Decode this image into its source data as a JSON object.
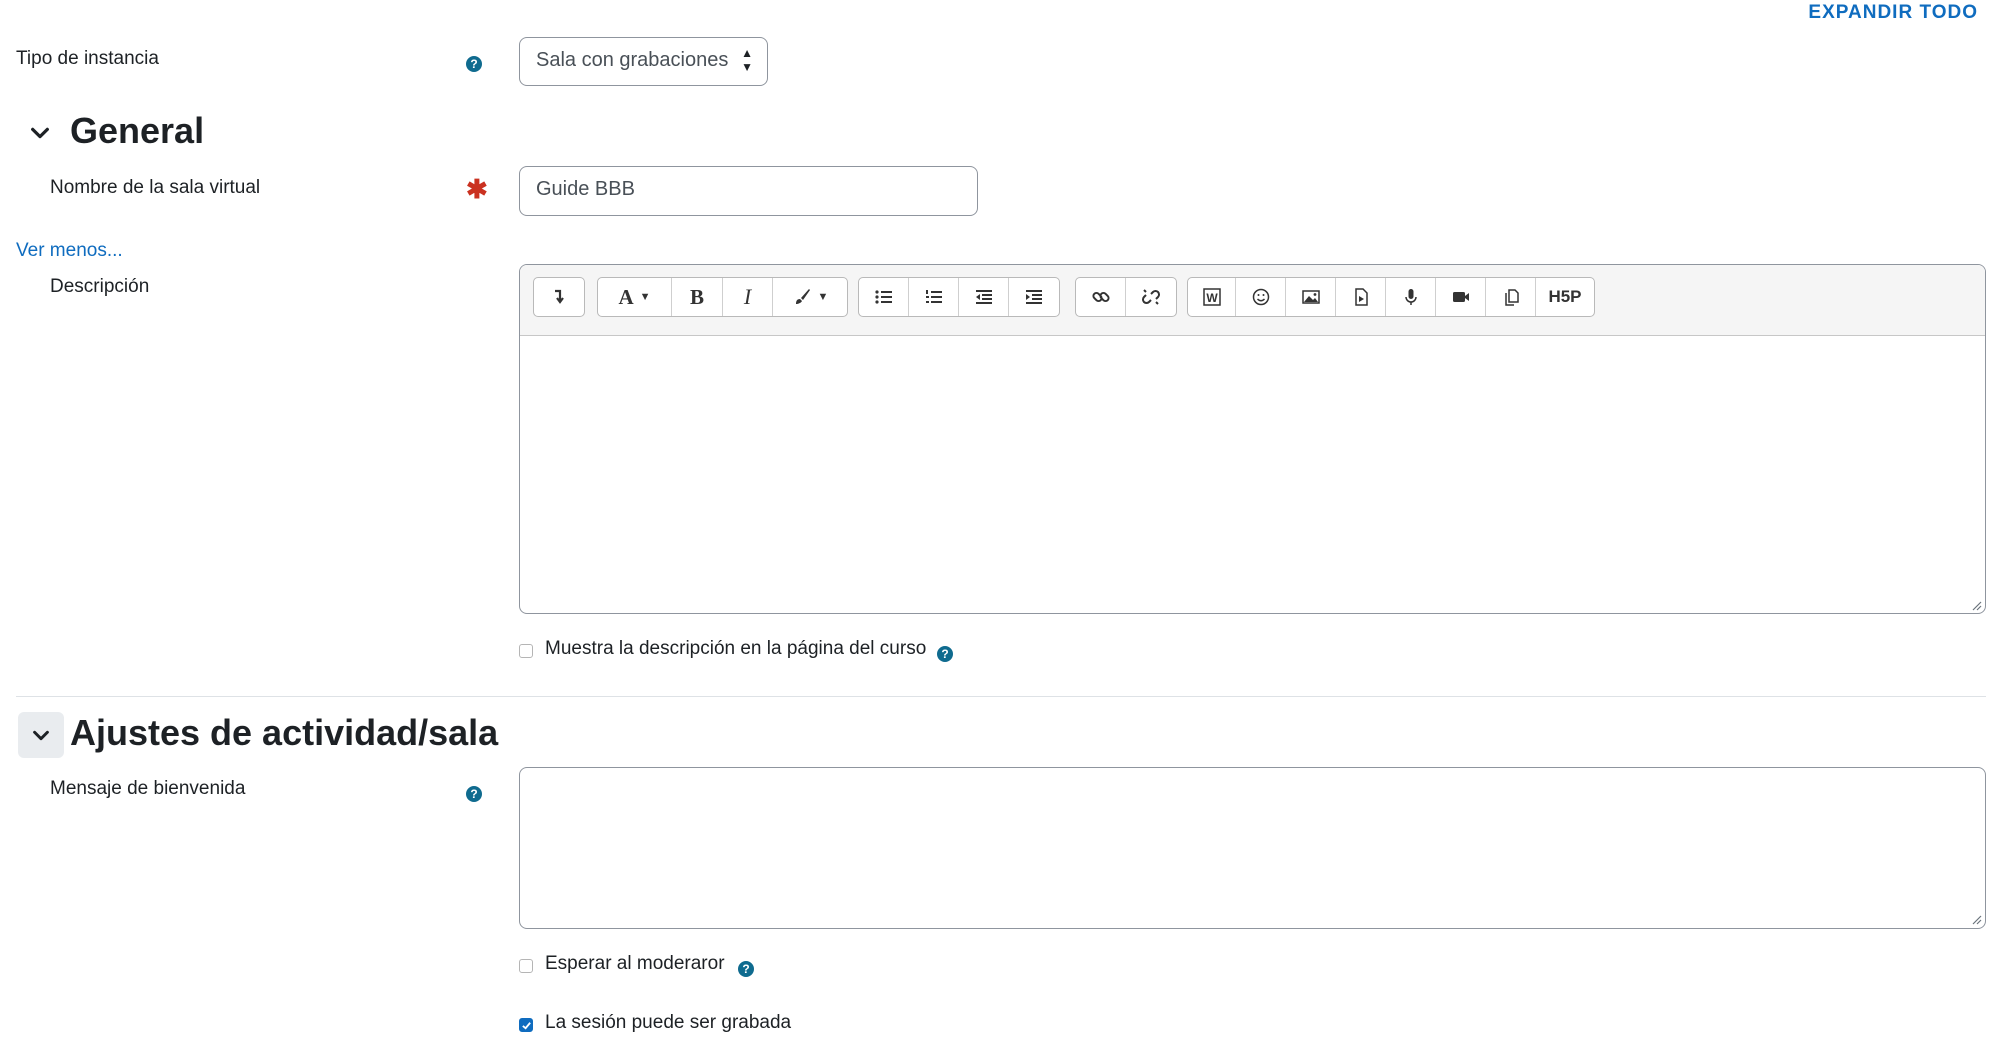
{
  "header": {
    "expand_all": "EXPANDIR TODO"
  },
  "instance_type": {
    "label": "Tipo de instancia",
    "value": "Sala con grabaciones",
    "help": "?"
  },
  "general": {
    "title": "General",
    "name_label": "Nombre de la sala virtual",
    "name_value": "Guide BBB",
    "required_mark": "✱",
    "show_less": "Ver menos...",
    "description_label": "Descripción",
    "editor_buttons": [
      "show-more",
      "font",
      "bold",
      "italic",
      "text-color",
      "unordered-list",
      "ordered-list",
      "outdent",
      "indent",
      "link",
      "unlink",
      "word-import",
      "emoticon",
      "image",
      "media",
      "record-audio",
      "record-video",
      "manage-files",
      "h5p"
    ],
    "editor_text": {
      "font": "A",
      "bold": "B",
      "italic": "I",
      "h5p": "H5P"
    },
    "show_description": {
      "label": "Muestra la descripción en la página del curso",
      "checked": false,
      "help": "?"
    }
  },
  "activity": {
    "title": "Ajustes de actividad/sala",
    "welcome_label": "Mensaje de bienvenida",
    "welcome_value": "",
    "welcome_help": "?",
    "wait_moderator": {
      "label": "Esperar al moderaror",
      "checked": false,
      "help": "?"
    },
    "recordable": {
      "label": "La sesión puede ser grabada",
      "checked": true
    }
  },
  "colors": {
    "link": "#0f6cbf",
    "help": "#0f6b8f",
    "required": "#ca3120"
  }
}
